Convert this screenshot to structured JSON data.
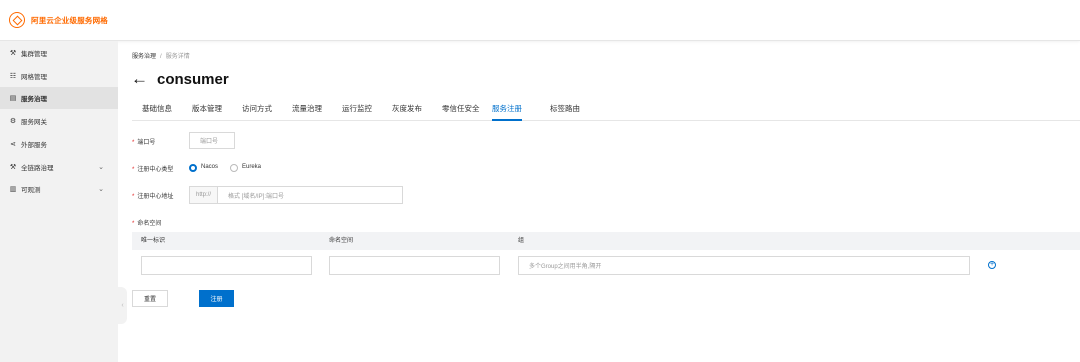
{
  "brand": {
    "name": "阿里云企业级服务网格"
  },
  "sidebar": {
    "items": [
      {
        "icon": "⚒",
        "label": "集群管理"
      },
      {
        "icon": "☷",
        "label": "网格管理"
      },
      {
        "icon": "▤",
        "label": "服务治理"
      },
      {
        "icon": "⚙",
        "label": "服务网关"
      },
      {
        "icon": "⋖",
        "label": "外部服务"
      },
      {
        "icon": "⚒",
        "label": "全链路治理",
        "chevron": "⌄"
      },
      {
        "icon": "▥",
        "label": "可观测",
        "chevron": "⌄"
      }
    ],
    "active_index": 2,
    "collapse_glyph": "‹"
  },
  "breadcrumb": {
    "parent": "服务治理",
    "separator": "/",
    "current": "服务详情"
  },
  "page": {
    "back_glyph": "←",
    "title": "consumer"
  },
  "tabs": [
    "基础信息",
    "版本管理",
    "访问方式",
    "流量治理",
    "运行监控",
    "灰度发布",
    "零信任安全",
    "服务注册",
    "标签路由"
  ],
  "active_tab": "服务注册",
  "form": {
    "required_mark": "*",
    "port": {
      "label": "端口号",
      "placeholder": "端口号",
      "value": ""
    },
    "registry_type": {
      "label": "注册中心类型",
      "options": [
        "Nacos",
        "Eureka"
      ],
      "selected": "Nacos"
    },
    "registry_address": {
      "label": "注册中心地址",
      "prefix": "http://",
      "placeholder": "格式 [域名/IP]:端口号",
      "value": ""
    },
    "namespace": {
      "label": "命名空间",
      "columns": [
        "唯一标识",
        "命名空间",
        "组"
      ],
      "row": {
        "id": "",
        "namespace": "",
        "group_placeholder": "多个Group之间用半角,隔开"
      }
    }
  },
  "actions": {
    "reset_label": "重置",
    "submit_label": "注册",
    "add_glyph": "+"
  },
  "colors": {
    "brand": "#ff6a00",
    "primary": "#0070cc",
    "required": "#e02020"
  }
}
